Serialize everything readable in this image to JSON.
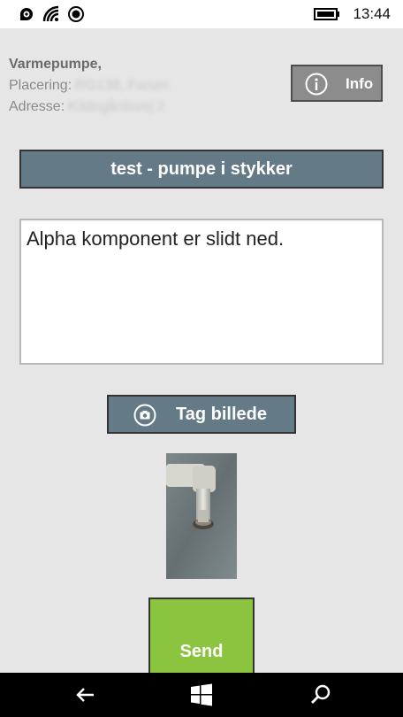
{
  "status_bar": {
    "time": "13:44",
    "icons": [
      "nfc-icon",
      "wifi-icon",
      "record-icon",
      "battery-icon"
    ]
  },
  "header": {
    "title": "Varmepumpe,",
    "placement_label": "Placering:",
    "placement_value": "RG138, Farum",
    "address_label": "Adresse:",
    "address_value": "Kildegårdsvej 2"
  },
  "info_button": {
    "label": "Info",
    "icon": "info-icon"
  },
  "task_title": "test - pumpe i stykker",
  "description": {
    "value": "Alpha komponent er slidt ned."
  },
  "photo_button": {
    "label": "Tag billede",
    "icon": "camera-icon"
  },
  "photo_thumbnail": {
    "icon": "pipe-photo"
  },
  "send_button": {
    "label": "Send"
  },
  "nav_bar": {
    "icons": [
      "back-arrow-icon",
      "windows-icon",
      "search-icon"
    ]
  },
  "colors": {
    "accent_button": "#647a87",
    "send": "#8bc53f",
    "info_button": "#8c8c8c",
    "background": "#e6e6e6"
  }
}
